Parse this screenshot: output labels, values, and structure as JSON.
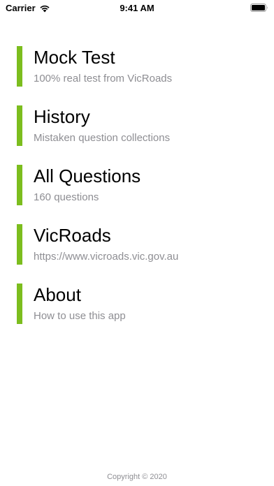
{
  "status_bar": {
    "carrier": "Carrier",
    "time": "9:41 AM",
    "wifi_icon": "wifi-icon",
    "battery_icon": "battery-icon"
  },
  "menu": {
    "accent_color": "#7cbd1e",
    "items": [
      {
        "title": "Mock Test",
        "subtitle": "100% real test from VicRoads"
      },
      {
        "title": "History",
        "subtitle": "Mistaken question collections"
      },
      {
        "title": "All Questions",
        "subtitle": "160 questions"
      },
      {
        "title": "VicRoads",
        "subtitle": "https://www.vicroads.vic.gov.au"
      },
      {
        "title": "About",
        "subtitle": "How to use this app"
      }
    ]
  },
  "footer": {
    "copyright": "Copyright © 2020"
  }
}
